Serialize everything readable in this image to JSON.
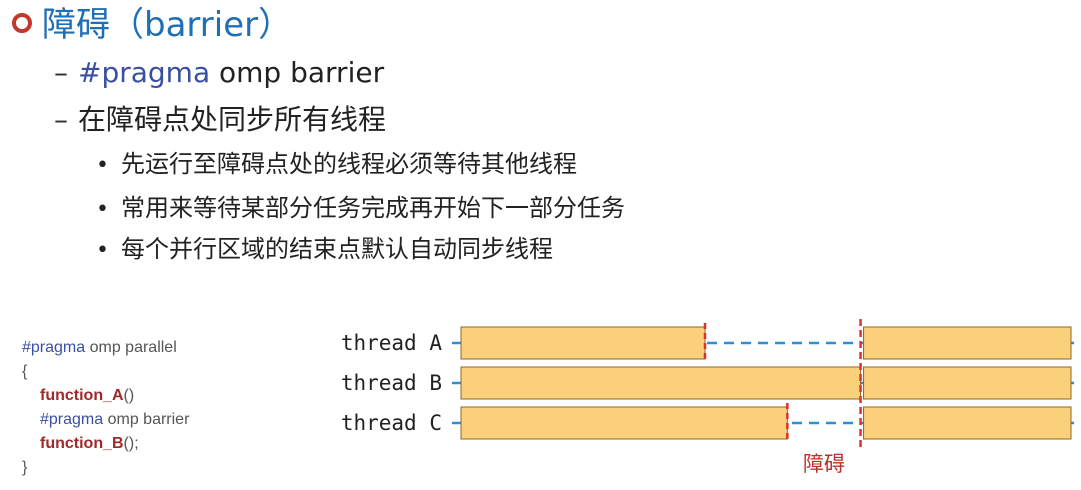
{
  "heading": {
    "text": "障碍（barrier）"
  },
  "bullets_l1": [
    {
      "dash": "–",
      "keyword": "#pragma",
      "rest": " omp barrier"
    },
    {
      "dash": "–",
      "keyword": "",
      "rest": "在障碍点处同步所有线程"
    }
  ],
  "bullets_l2": [
    {
      "dot": "•",
      "text": "先运行至障碍点处的线程必须等待其他线程"
    },
    {
      "dot": "•",
      "text": "常用来等待某部分任务完成再开始下一部分任务"
    },
    {
      "dot": "•",
      "text": "每个并行区域的结束点默认自动同步线程"
    }
  ],
  "code": {
    "line1_kw": "#pragma",
    "line1_rest": " omp parallel",
    "open_brace": "{",
    "fn_a": "function_A",
    "fn_a_suffix": "()",
    "line3_kw": "#pragma",
    "line3_rest": " omp barrier",
    "fn_b": "function_B",
    "fn_b_suffix": "();",
    "close_brace": "}"
  },
  "diagram": {
    "threads": [
      {
        "label": "thread A",
        "first_end": 0.4
      },
      {
        "label": "thread B",
        "first_end": 0.655
      },
      {
        "label": "thread C",
        "first_end": 0.535
      }
    ],
    "barrier_pos": 0.655,
    "barrier_label": "障碍",
    "colors": {
      "bar_fill": "#fbd07a",
      "bar_stroke": "#8a6a2a",
      "wait_line": "#2a8fd6",
      "barrier_line": "#e0302a",
      "barrier_label": "#c0302a"
    }
  }
}
